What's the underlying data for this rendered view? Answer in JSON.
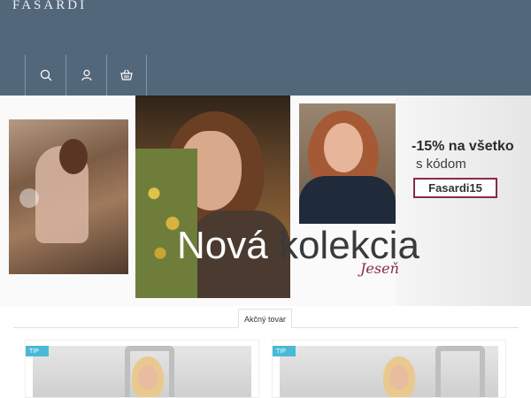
{
  "header": {
    "logo": "FASARDI",
    "background": "#53677a",
    "icons": [
      {
        "name": "search-icon"
      },
      {
        "name": "user-icon"
      },
      {
        "name": "basket-icon"
      }
    ]
  },
  "banner": {
    "promo_line1": "-15% na všetko",
    "promo_line2": "s kódom",
    "promo_code": "Fasardi15",
    "headline_word1": "Nová",
    "headline_word2": "kolekcia",
    "headline_script": "Jeseň",
    "accent": "#8a2a48"
  },
  "section": {
    "tab_label": "Akčný tovar"
  },
  "products": [
    {
      "badge": "TIP"
    },
    {
      "badge": "TIP"
    }
  ],
  "colors": {
    "tip_badge": "#49b9d6"
  }
}
